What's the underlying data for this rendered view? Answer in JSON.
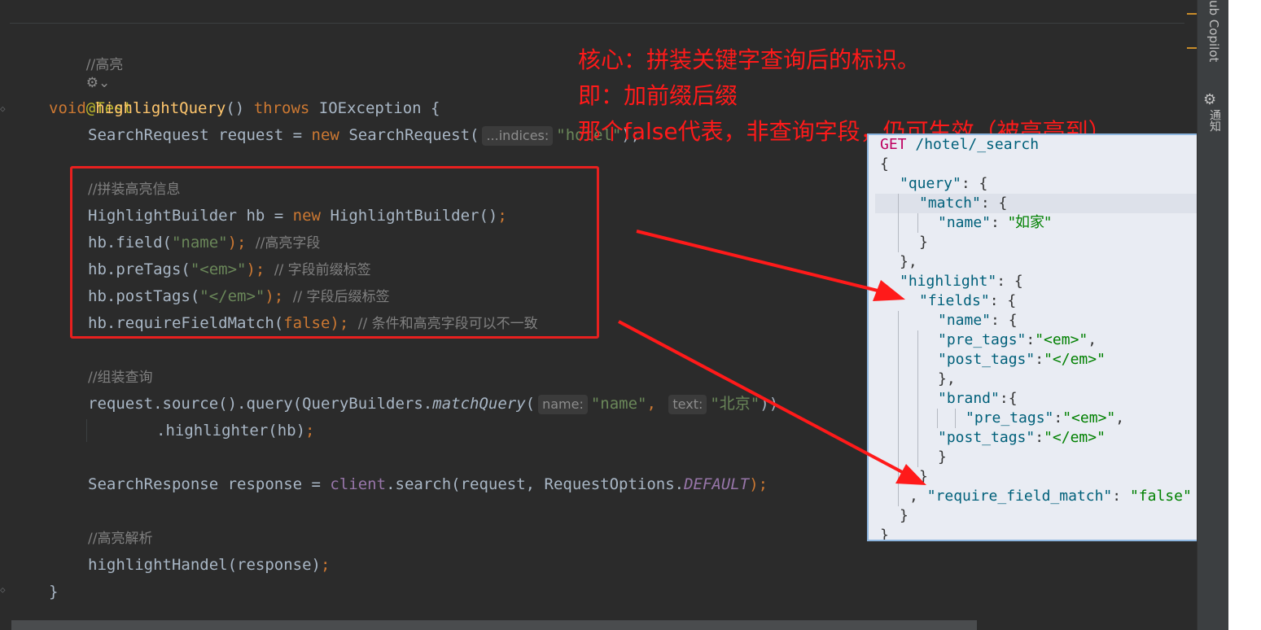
{
  "editor": {
    "lines": {
      "comment_highlight": "//高亮",
      "ai_icon": "⚙",
      "chevron": "⌄",
      "annotation_test": "@Test",
      "method_void": "void ",
      "method_name": "highlightQuery",
      "method_parens": "() ",
      "method_throws": "throws ",
      "method_exc": "IOException {",
      "req_a": "SearchRequest request = ",
      "req_new": "new ",
      "req_b": "SearchRequest(",
      "req_hint": "...indices:",
      "req_str": "\"hotel\"",
      "req_end": ");",
      "cmt_assemble": "//拼装高亮信息",
      "hb_a": "HighlightBuilder hb = ",
      "hb_new": "new ",
      "hb_b": "HighlightBuilder()",
      "hb_semi": ";",
      "field_a": "hb.field(",
      "field_str": "\"name\"",
      "field_b": "); ",
      "field_cmt": "//高亮字段",
      "pre_a": "hb.preTags(",
      "pre_str": "\"<em>\"",
      "pre_b": "); ",
      "pre_cmt": "// 字段前缀标签",
      "post_a": "hb.postTags(",
      "post_str": "\"</em>\"",
      "post_b": "); ",
      "post_cmt": "// 字段后缀标签",
      "rfm_a": "hb.requireFieldMatch(",
      "rfm_kw": "false",
      "rfm_b": "); ",
      "rfm_cmt": "// 条件和高亮字段可以不一致",
      "cmt_query": "//组装查询",
      "src_a": "request.source().query(QueryBuilders.",
      "src_fn": "matchQuery",
      "src_paren": "(",
      "src_hint_name": "name:",
      "src_str_name": "\"name\"",
      "src_comma": ", ",
      "src_hint_text": "text:",
      "src_str_text": "\"北京\"",
      "src_end": "))",
      "hl_a": ".highlighter(hb)",
      "hl_semi": ";",
      "resp_a": "SearchResponse response = ",
      "resp_client": "client",
      "resp_b": ".search(request, RequestOptions.",
      "resp_default": "DEFAULT",
      "resp_end": ");",
      "cmt_parse": "//高亮解析",
      "handle_a": "highlightHandel(response)",
      "handle_semi": ";",
      "close_brace": "}"
    }
  },
  "annotation": {
    "line1": "核心：拼装关键字查询后的标识。",
    "line2": "即：加前缀后缀",
    "line3": "那个false代表，非查询字段，仍可生效（被高亮到）"
  },
  "dsl": {
    "l1_method": "GET",
    "l1_path": " /hotel/_search",
    "l2": "{",
    "l3_key": "\"query\"",
    "l3_rest": ": {",
    "l4_key": "\"match\"",
    "l4_rest": ": {",
    "l5_key": "\"name\"",
    "l5_colon": ": ",
    "l5_val": "\"如家\"",
    "l6": "}",
    "l7": "},",
    "l8_key": "\"highlight\"",
    "l8_rest": ": {",
    "l9_key": "\"fields\"",
    "l9_rest": ": {",
    "l10_key": "\"name\"",
    "l10_rest": ": {",
    "l11_key": "\"pre_tags\"",
    "l11_colon": ":",
    "l11_val": "\"<em>\"",
    "l11_comma": ",",
    "l12_key": "\"post_tags\"",
    "l12_colon": ":",
    "l12_val": "\"</em>\"",
    "l13": "},",
    "l14_key": "\"brand\"",
    "l14_rest": ":{",
    "l15_key": "\"pre_tags\"",
    "l15_colon": ":",
    "l15_val": "\"<em>\"",
    "l15_comma": ",",
    "l16_key": "\"post_tags\"",
    "l16_colon": ":",
    "l16_val": "\"</em>\"",
    "l17": "}",
    "l18": "}",
    "l19_comma": ", ",
    "l19_key": "\"require_field_match\"",
    "l19_colon": ": ",
    "l19_val": "\"false\"",
    "l20": "}",
    "l21": "}"
  },
  "side_panel": {
    "copilot_label": "ub Copilot",
    "notif_label": "通知"
  },
  "colors": {
    "editor_bg": "#2b2b2b",
    "annotation_red": "#ff1a1a",
    "box_red": "#e8201f",
    "panel_bg": "#e9ecf3"
  }
}
